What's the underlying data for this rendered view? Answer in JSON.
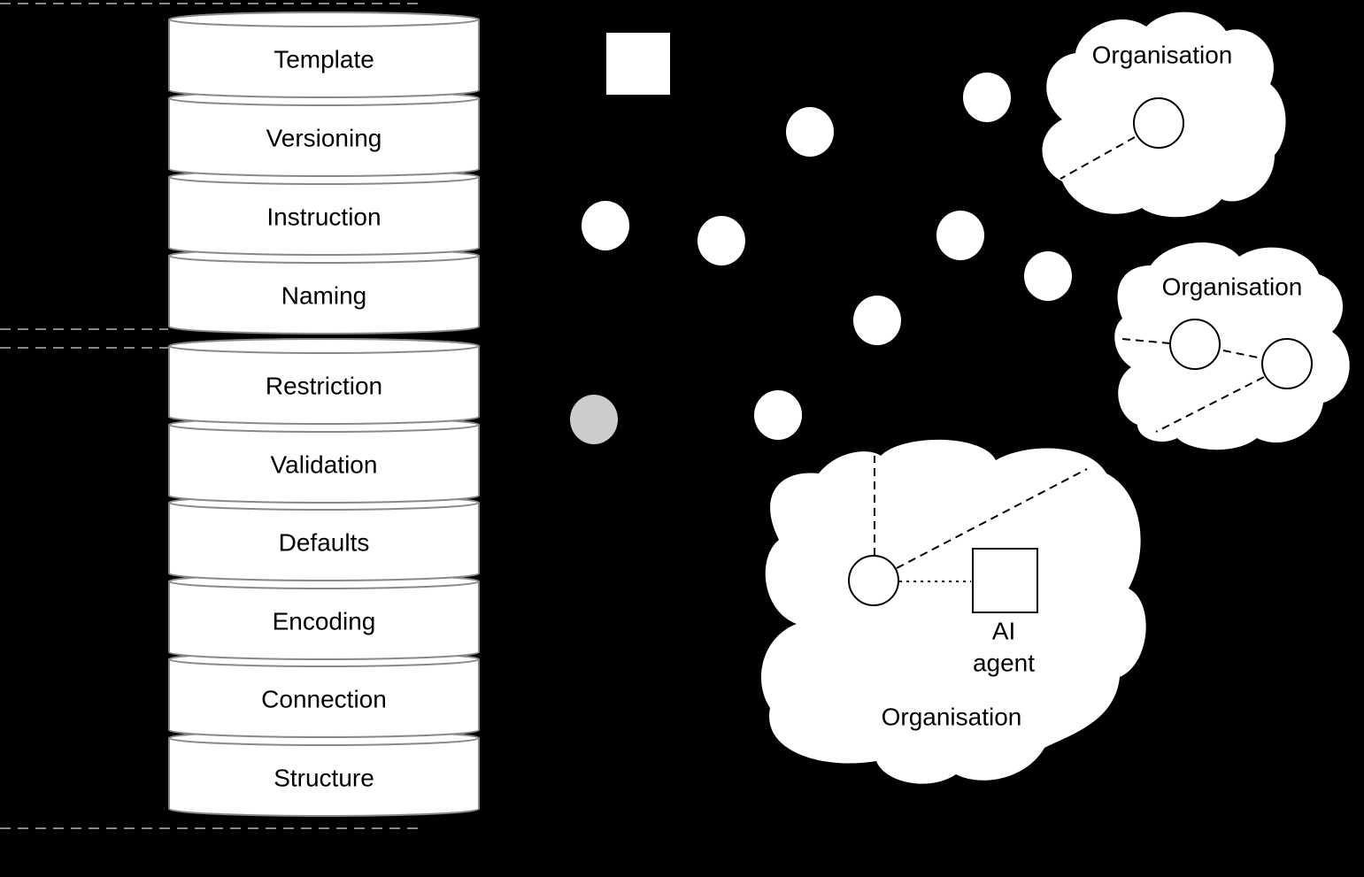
{
  "stack": {
    "upper_layers": [
      "Template",
      "Versioning",
      "Instruction",
      "Naming"
    ],
    "lower_layers": [
      "Restriction",
      "Validation",
      "Defaults",
      "Encoding",
      "Connection",
      "Structure"
    ],
    "colors": {
      "fill": "#ffffff",
      "stroke": "#888888",
      "divider": "#888888"
    }
  },
  "nodes": {
    "colors": {
      "node": "#ffffff",
      "highlighted_node": "#cccccc",
      "background": "#000000"
    }
  },
  "clouds": [
    {
      "label": "Organisation"
    },
    {
      "label": "Organisation"
    },
    {
      "label": "Organisation",
      "agent_label_line1": "AI",
      "agent_label_line2": "agent"
    }
  ]
}
